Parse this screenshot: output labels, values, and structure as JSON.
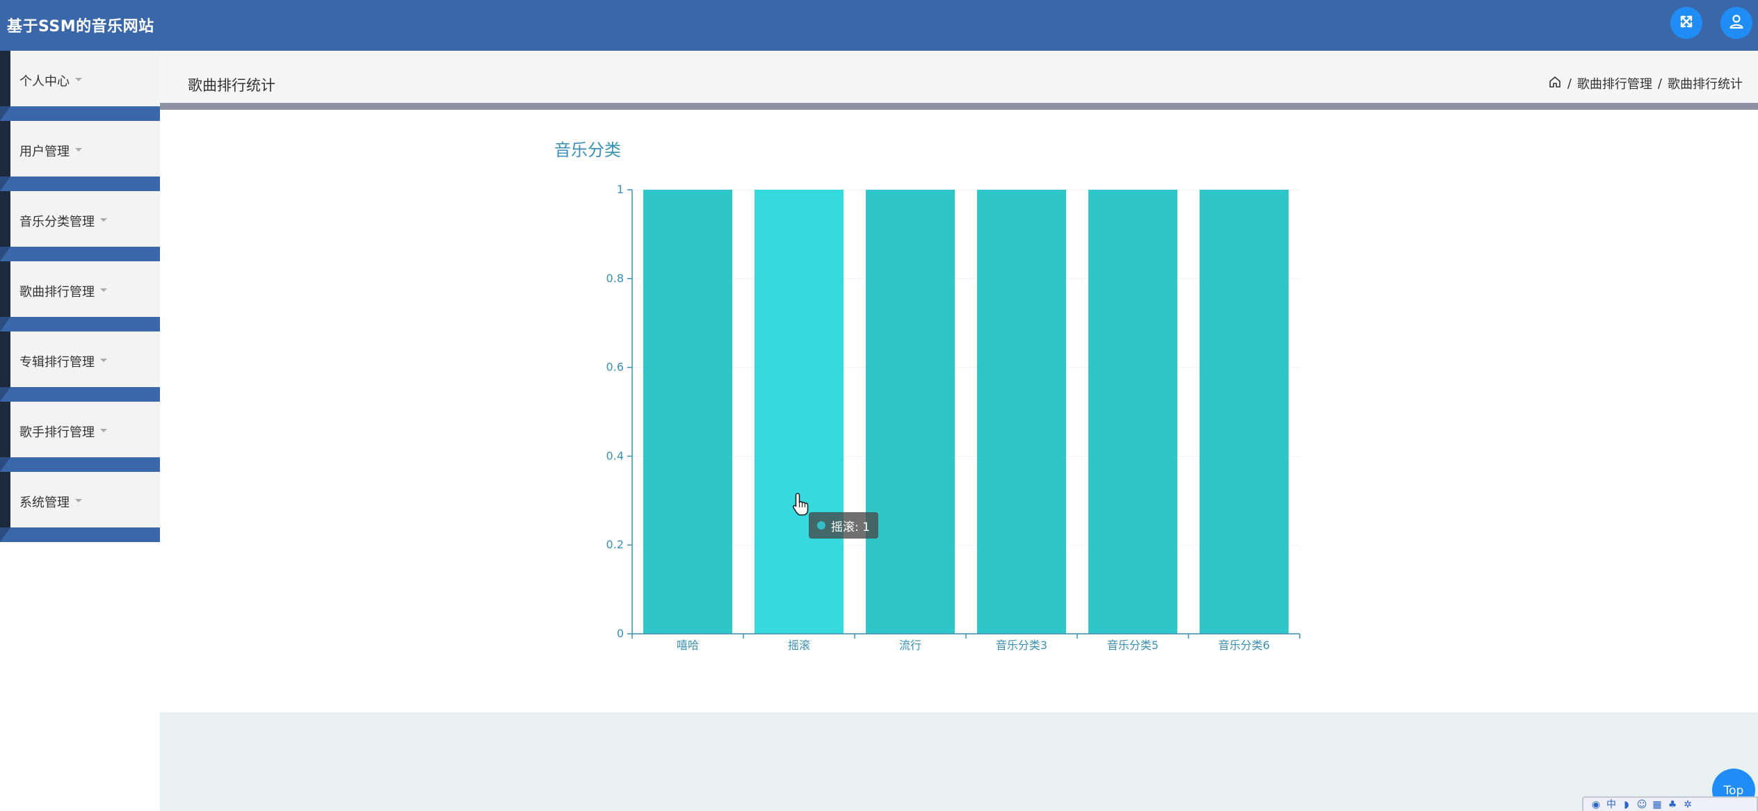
{
  "header": {
    "app_title": "基于SSM的音乐网站",
    "buttons": [
      {
        "name": "fullscreen",
        "icon": "fullscreen-icon"
      },
      {
        "name": "user",
        "icon": "user-icon"
      }
    ]
  },
  "sidebar": {
    "items": [
      {
        "label": "个人中心"
      },
      {
        "label": "用户管理"
      },
      {
        "label": "音乐分类管理"
      },
      {
        "label": "歌曲排行管理"
      },
      {
        "label": "专辑排行管理"
      },
      {
        "label": "歌手排行管理"
      },
      {
        "label": "系统管理"
      }
    ]
  },
  "page": {
    "title": "歌曲排行统计",
    "breadcrumb": [
      "歌曲排行管理",
      "歌曲排行统计"
    ],
    "breadcrumb_sep": "/",
    "home_icon": "home-icon"
  },
  "chart_data": {
    "type": "bar",
    "title": "音乐分类",
    "categories": [
      "嘻哈",
      "摇滚",
      "流行",
      "音乐分类3",
      "音乐分类5",
      "音乐分类6"
    ],
    "values": [
      1,
      1,
      1,
      1,
      1,
      1
    ],
    "ylim": [
      0,
      1
    ],
    "yticks": [
      "0",
      "0.2",
      "0.4",
      "0.6",
      "0.8",
      "1"
    ],
    "highlighted_index": 1,
    "colors": {
      "bar": "#2fc6c9",
      "bar_highlight": "#35dadf",
      "axis": "#3a8fb4"
    },
    "tooltip": {
      "label": "摇滚",
      "value": "1",
      "text": "摇滚: 1"
    }
  },
  "footer": {
    "top_button": "Top"
  },
  "ime": {
    "mode_label": "中"
  },
  "colors": {
    "header_bg": "#3a67a9",
    "accent": "#1f8df5",
    "sidebar_dark": "#1d2a3e"
  }
}
